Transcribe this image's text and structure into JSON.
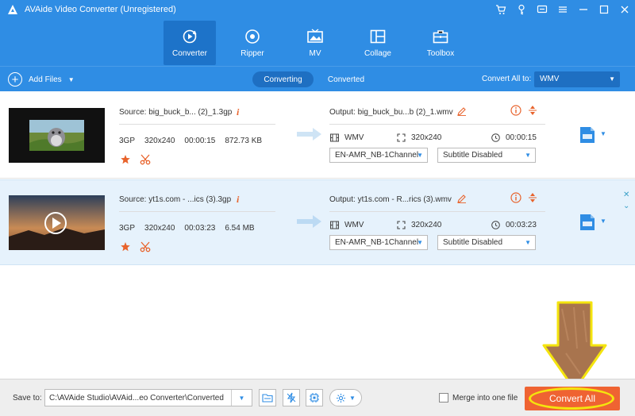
{
  "app": {
    "title": "AVAide Video Converter (Unregistered)"
  },
  "nav": {
    "tabs": [
      {
        "label": "Converter",
        "icon": "converter-icon",
        "active": true
      },
      {
        "label": "Ripper",
        "icon": "ripper-icon",
        "active": false
      },
      {
        "label": "MV",
        "icon": "mv-icon",
        "active": false
      },
      {
        "label": "Collage",
        "icon": "collage-icon",
        "active": false
      },
      {
        "label": "Toolbox",
        "icon": "toolbox-icon",
        "active": false
      }
    ]
  },
  "toolbar": {
    "add_files": "Add Files",
    "tab_converting": "Converting",
    "tab_converted": "Converted",
    "convert_all_to": "Convert All to:",
    "format": "WMV"
  },
  "files": [
    {
      "source": "Source: big_buck_b... (2)_1.3gp",
      "format": "3GP",
      "resolution": "320x240",
      "duration": "00:00:15",
      "size": "872.73 KB",
      "output": "Output: big_buck_bu...b (2)_1.wmv",
      "out_format": "WMV",
      "out_resolution": "320x240",
      "out_duration": "00:00:15",
      "audio": "EN-AMR_NB-1Channel",
      "subtitle": "Subtitle Disabled"
    },
    {
      "source": "Source: yt1s.com - ...ics (3).3gp",
      "format": "3GP",
      "resolution": "320x240",
      "duration": "00:03:23",
      "size": "6.54 MB",
      "output": "Output: yt1s.com - R...rics (3).wmv",
      "out_format": "WMV",
      "out_resolution": "320x240",
      "out_duration": "00:03:23",
      "audio": "EN-AMR_NB-1Channel",
      "subtitle": "Subtitle Disabled"
    }
  ],
  "bottom": {
    "save_to": "Save to:",
    "path": "C:\\AVAide Studio\\AVAid...eo Converter\\Converted",
    "merge_label": "Merge into one file",
    "convert_all": "Convert All"
  },
  "colors": {
    "header": "#2f8de4",
    "accent_orange": "#ef6332",
    "highlight_yellow": "#f4e40e",
    "arrow_brown": "#a8744e"
  }
}
